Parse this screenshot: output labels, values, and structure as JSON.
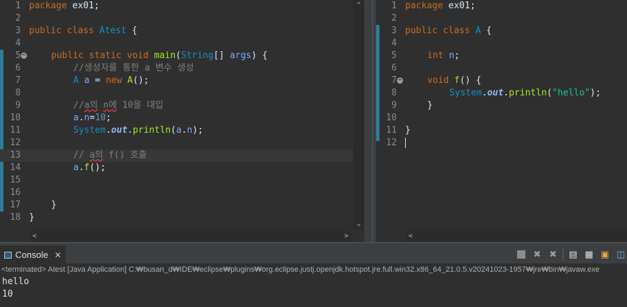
{
  "left_editor": {
    "lines": [
      {
        "n": "1",
        "t": [
          {
            "c": "kw",
            "v": "package"
          },
          {
            "c": "",
            "v": " ex01;"
          }
        ]
      },
      {
        "n": "2",
        "t": []
      },
      {
        "n": "3",
        "t": [
          {
            "c": "kw",
            "v": "public"
          },
          {
            "c": "",
            "v": " "
          },
          {
            "c": "kw",
            "v": "class"
          },
          {
            "c": "",
            "v": " "
          },
          {
            "c": "cls",
            "v": "Atest"
          },
          {
            "c": "",
            "v": " {"
          }
        ]
      },
      {
        "n": "4",
        "t": []
      },
      {
        "n": "5",
        "fold": true,
        "ind": 1,
        "t": [
          {
            "c": "kw",
            "v": "public"
          },
          {
            "c": "",
            "v": " "
          },
          {
            "c": "kw",
            "v": "static"
          },
          {
            "c": "",
            "v": " "
          },
          {
            "c": "kw",
            "v": "void"
          },
          {
            "c": "",
            "v": " "
          },
          {
            "c": "fn",
            "v": "main"
          },
          {
            "c": "",
            "v": "("
          },
          {
            "c": "cls",
            "v": "String"
          },
          {
            "c": "",
            "v": "[] "
          },
          {
            "c": "var",
            "v": "args"
          },
          {
            "c": "",
            "v": ") {"
          }
        ]
      },
      {
        "n": "6",
        "ind": 2,
        "t": [
          {
            "c": "cmt",
            "v": "//생성자를 통한 a 변수 생성"
          }
        ]
      },
      {
        "n": "7",
        "ind": 2,
        "t": [
          {
            "c": "cls",
            "v": "A"
          },
          {
            "c": "",
            "v": " "
          },
          {
            "c": "var",
            "v": "a"
          },
          {
            "c": "",
            "v": " = "
          },
          {
            "c": "kw",
            "v": "new"
          },
          {
            "c": "",
            "v": " "
          },
          {
            "c": "fn",
            "v": "A"
          },
          {
            "c": "",
            "v": "();"
          }
        ]
      },
      {
        "n": "8",
        "t": []
      },
      {
        "n": "9",
        "ind": 2,
        "t": [
          {
            "c": "cmt",
            "v": "//"
          },
          {
            "c": "cmt squig",
            "v": "a의"
          },
          {
            "c": "cmt",
            "v": " "
          },
          {
            "c": "cmt squig",
            "v": "n에"
          },
          {
            "c": "cmt",
            "v": " 10을 대입"
          }
        ]
      },
      {
        "n": "10",
        "ind": 2,
        "t": [
          {
            "c": "var",
            "v": "a"
          },
          {
            "c": "",
            "v": "."
          },
          {
            "c": "var",
            "v": "n"
          },
          {
            "c": "",
            "v": "="
          },
          {
            "c": "num",
            "v": "10"
          },
          {
            "c": "",
            "v": ";"
          }
        ]
      },
      {
        "n": "11",
        "ind": 2,
        "t": [
          {
            "c": "cls",
            "v": "System"
          },
          {
            "c": "",
            "v": "."
          },
          {
            "c": "out",
            "v": "out"
          },
          {
            "c": "",
            "v": "."
          },
          {
            "c": "fn",
            "v": "println"
          },
          {
            "c": "",
            "v": "("
          },
          {
            "c": "var",
            "v": "a"
          },
          {
            "c": "",
            "v": "."
          },
          {
            "c": "var",
            "v": "n"
          },
          {
            "c": "",
            "v": ");"
          }
        ]
      },
      {
        "n": "12",
        "t": []
      },
      {
        "n": "13",
        "ind": 2,
        "cur": true,
        "t": [
          {
            "c": "cmt",
            "v": "// "
          },
          {
            "c": "cmt squig",
            "v": "a의"
          },
          {
            "c": "cmt",
            "v": " f() 호출"
          }
        ]
      },
      {
        "n": "14",
        "ind": 2,
        "t": [
          {
            "c": "var",
            "v": "a"
          },
          {
            "c": "",
            "v": "."
          },
          {
            "c": "fn",
            "v": "f"
          },
          {
            "c": "",
            "v": "();"
          }
        ]
      },
      {
        "n": "15",
        "t": []
      },
      {
        "n": "16",
        "t": []
      },
      {
        "n": "17",
        "ind": 1,
        "t": [
          {
            "c": "",
            "v": "}"
          }
        ]
      },
      {
        "n": "18",
        "t": [
          {
            "c": "",
            "v": "}"
          }
        ]
      }
    ]
  },
  "right_editor": {
    "lines": [
      {
        "n": "1",
        "t": [
          {
            "c": "kw",
            "v": "package"
          },
          {
            "c": "",
            "v": " ex01;"
          }
        ]
      },
      {
        "n": "2",
        "t": []
      },
      {
        "n": "3",
        "t": [
          {
            "c": "kw",
            "v": "public"
          },
          {
            "c": "",
            "v": " "
          },
          {
            "c": "kw",
            "v": "class"
          },
          {
            "c": "",
            "v": " "
          },
          {
            "c": "cls",
            "v": "A"
          },
          {
            "c": "",
            "v": " {"
          }
        ]
      },
      {
        "n": "4",
        "t": []
      },
      {
        "n": "5",
        "ind": 1,
        "t": [
          {
            "c": "kw",
            "v": "int"
          },
          {
            "c": "",
            "v": " "
          },
          {
            "c": "var",
            "v": "n"
          },
          {
            "c": "",
            "v": ";"
          }
        ]
      },
      {
        "n": "6",
        "t": []
      },
      {
        "n": "7",
        "fold": true,
        "ind": 1,
        "t": [
          {
            "c": "kw",
            "v": "void"
          },
          {
            "c": "",
            "v": " "
          },
          {
            "c": "fn",
            "v": "f"
          },
          {
            "c": "",
            "v": "() {"
          }
        ]
      },
      {
        "n": "8",
        "ind": 2,
        "t": [
          {
            "c": "cls",
            "v": "System"
          },
          {
            "c": "",
            "v": "."
          },
          {
            "c": "out",
            "v": "out"
          },
          {
            "c": "",
            "v": "."
          },
          {
            "c": "fn",
            "v": "println"
          },
          {
            "c": "",
            "v": "("
          },
          {
            "c": "str",
            "v": "\"hello\""
          },
          {
            "c": "",
            "v": ");"
          }
        ]
      },
      {
        "n": "9",
        "ind": 1,
        "t": [
          {
            "c": "",
            "v": "}"
          }
        ]
      },
      {
        "n": "10",
        "t": []
      },
      {
        "n": "11",
        "t": [
          {
            "c": "",
            "v": "}"
          }
        ]
      },
      {
        "n": "12",
        "cursor": true,
        "t": []
      }
    ]
  },
  "console": {
    "tab_label": "Console",
    "terminated_text": "<terminated> Atest [Java Application] C:₩busan_d₩IDE₩eclipse₩plugins₩org.eclipse.justj.openjdk.hotspot.jre.full.win32.x86_64_21.0.5.v20241023-1957₩jre₩bin₩javaw.exe",
    "output": [
      "hello",
      "10"
    ]
  },
  "colors": {
    "keyword": "#cc6c1d",
    "class": "#1290c3",
    "method": "#a7ec21",
    "variable": "#79abff",
    "comment": "#808080",
    "string": "#17c6a3",
    "number": "#6897bb"
  },
  "icons": [
    "fold-marker-icon",
    "console-icon",
    "close-icon",
    "terminate-icon",
    "remove-launch-icon",
    "remove-all-icon",
    "scroll-lock-icon",
    "show-on-output-icon",
    "pin-console-icon",
    "display-console-icon"
  ]
}
